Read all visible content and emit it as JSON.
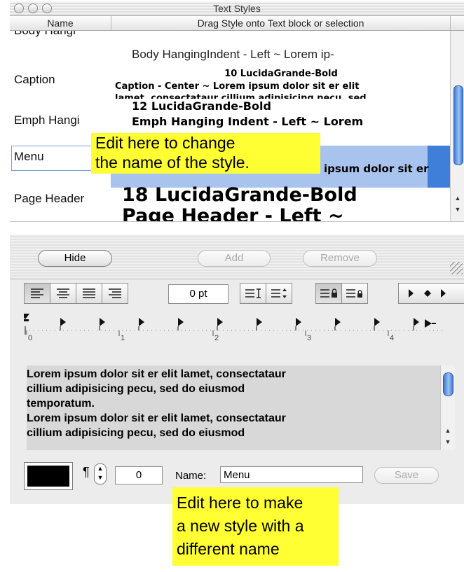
{
  "window": {
    "title": "Text Styles"
  },
  "table": {
    "headers": {
      "name": "Name",
      "preview": "Drag Style onto Text block or selection"
    },
    "rows": [
      {
        "name": "Body Hangi",
        "preview_lines": [
          "Body HangingIndent - Left ~ Lorem ip-"
        ]
      },
      {
        "name": "Caption",
        "preview_lines": [
          "10 LucidaGrande-Bold",
          "Caption - Center ~ Lorem ipsum dolor sit er elit",
          "lamet, consectataur cillium adipisicing pecu, sed"
        ]
      },
      {
        "name": "Emph Hangi",
        "preview_lines": [
          "12 LucidaGrande-Bold",
          "Emph Hanging Indent - Left ~ Lorem"
        ]
      },
      {
        "name": "Menu",
        "preview_lines": [
          "ipsum dolor sit er"
        ]
      },
      {
        "name": "Page Header",
        "preview_lines": [
          "18 LucidaGrande-Bold",
          "Page Header - Left ~"
        ]
      }
    ]
  },
  "buttons": {
    "hide": "Hide",
    "add": "Add",
    "remove": "Remove",
    "save": "Save"
  },
  "format_bar": {
    "spacing_value": "0 pt",
    "align_icons": [
      "align-left-icon",
      "align-center-icon",
      "align-justify-icon",
      "align-right-icon"
    ]
  },
  "ruler": {
    "numbers": [
      "0",
      "1",
      "2",
      "3",
      "4"
    ]
  },
  "text_view": {
    "lines": [
      "Lorem ipsum dolor sit er elit lamet, consectataur",
      "cillium adipisicing pecu, sed do eiusmod",
      "temporatum.",
      "Lorem ipsum dolor sit er elit lamet, consectataur",
      "cillium adipisicing pecu, sed do eiusmod"
    ]
  },
  "bottom_bar": {
    "indent_value": "0",
    "name_label": "Name:",
    "name_value": "Menu",
    "color": "#000000"
  },
  "callouts": {
    "top": [
      "Edit here to change",
      "the name of the style."
    ],
    "bottom": [
      "Edit here to make",
      "a new style with a",
      "different name"
    ]
  },
  "colors": {
    "highlight": "#a8c4ee",
    "callout": "#ffff33",
    "scroll_thumb": "#3d78d6"
  }
}
